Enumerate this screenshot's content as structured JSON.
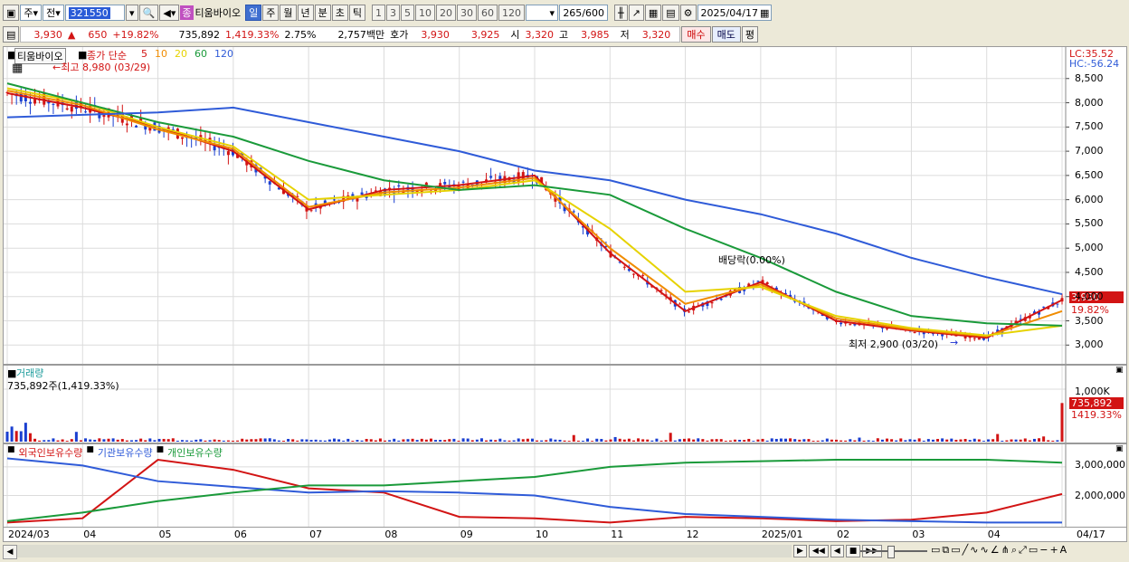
{
  "toolbar": {
    "period": "주",
    "all": "전",
    "code": "321550",
    "stock_badge": "종",
    "stock_name": "티움바이오",
    "timeframes": [
      "일",
      "주",
      "월",
      "년",
      "분",
      "초",
      "틱"
    ],
    "timeframe_selected": "일",
    "intervals": [
      "1",
      "3",
      "5",
      "10",
      "20",
      "30",
      "60",
      "120"
    ],
    "count": "265",
    "count_total": "/600",
    "date": "2025/04/17"
  },
  "quote": {
    "price": "3,930",
    "arrow": "▲",
    "change": "650",
    "change_pct": "+19.82%",
    "volume": "735,892",
    "volume_pct": "1,419.33%",
    "turnover": "2.75%",
    "amount": "2,757백만",
    "hoga_label": "호가",
    "ask": "3,930",
    "bid": "3,925",
    "open_label": "시",
    "open": "3,320",
    "high_label": "고",
    "high": "3,985",
    "low_label": "저",
    "low": "3,320",
    "buy": "매수",
    "sell": "매도",
    "eval": "평"
  },
  "price_pane": {
    "name": "티움바이오",
    "legend_prefix": "종가 단순",
    "ma": [
      {
        "label": "5",
        "color": "#d21414"
      },
      {
        "label": "10",
        "color": "#f08c00"
      },
      {
        "label": "20",
        "color": "#e6d200"
      },
      {
        "label": "60",
        "color": "#1a9a3a"
      },
      {
        "label": "120",
        "color": "#2f5bd8"
      }
    ],
    "high_note": "←최고 8,980 (03/29)",
    "low_note": "최저 2,900 (03/20)",
    "dividend_note": "배당락(0.00%)",
    "lc": "LC:35.52",
    "hc": "HC:-56.24",
    "current_price": "3,930",
    "current_pct": "19.82%",
    "yticks": [
      "8,500",
      "8,000",
      "7,500",
      "7,000",
      "6,500",
      "6,000",
      "5,500",
      "5,000",
      "4,500",
      "4,000",
      "3,500",
      "3,000"
    ]
  },
  "volume_pane": {
    "title": "거래량",
    "current": "735,892주(1,419.33%)",
    "ytick": "1,000K",
    "badge": "735,892",
    "badge_pct": "1419.33%"
  },
  "investor_pane": {
    "legend": [
      {
        "label": "외국인보유수량",
        "color": "#d21414"
      },
      {
        "label": "기관보유수량",
        "color": "#2f5bd8"
      },
      {
        "label": "개인보유수량",
        "color": "#1a9a3a"
      }
    ],
    "yticks": [
      "3,000,000",
      "2,000,000"
    ]
  },
  "xaxis": {
    "labels": [
      "2024/03",
      "04",
      "05",
      "06",
      "07",
      "08",
      "09",
      "10",
      "11",
      "12",
      "2025/01",
      "02",
      "03",
      "04"
    ],
    "right_label": "04/17"
  },
  "chart_data": {
    "type": "line",
    "title": "티움바이오",
    "ylim": [
      2800,
      9000
    ],
    "x": [
      "2024/03",
      "2024/04",
      "2024/05",
      "2024/06",
      "2024/07",
      "2024/08",
      "2024/09",
      "2024/10",
      "2024/11",
      "2024/12",
      "2025/01",
      "2025/02",
      "2025/03",
      "2025/04",
      "2025/04/17"
    ],
    "series": [
      {
        "name": "5",
        "values": [
          8200,
          7900,
          7500,
          7000,
          5800,
          6200,
          6300,
          6500,
          4900,
          3700,
          4300,
          3500,
          3300,
          3150,
          3930
        ]
      },
      {
        "name": "10",
        "values": [
          8250,
          7950,
          7450,
          7050,
          5850,
          6150,
          6250,
          6450,
          5000,
          3850,
          4250,
          3550,
          3320,
          3180,
          3700
        ]
      },
      {
        "name": "20",
        "values": [
          8300,
          8000,
          7500,
          7100,
          6000,
          6100,
          6200,
          6400,
          5400,
          4100,
          4200,
          3600,
          3350,
          3200,
          3400
        ]
      },
      {
        "name": "60",
        "values": [
          8400,
          8000,
          7600,
          7300,
          6800,
          6400,
          6200,
          6300,
          6100,
          5400,
          4800,
          4100,
          3600,
          3450,
          3400
        ]
      },
      {
        "name": "120",
        "values": [
          7700,
          7750,
          7800,
          7900,
          7600,
          7300,
          7000,
          6600,
          6400,
          6000,
          5700,
          5300,
          4800,
          4400,
          4050
        ]
      }
    ],
    "volume": {
      "ylim": [
        0,
        1000000
      ],
      "last": 735892
    },
    "holdings": {
      "ylim": [
        1000000,
        3600000
      ],
      "series": [
        {
          "name": "외국인보유수량",
          "values": [
            1050000,
            1200000,
            3250000,
            2900000,
            2250000,
            2100000,
            1250000,
            1200000,
            1050000,
            1250000,
            1200000,
            1100000,
            1150000,
            1400000,
            2050000
          ]
        },
        {
          "name": "기관보유수량",
          "values": [
            3300000,
            3050000,
            2500000,
            2300000,
            2100000,
            2150000,
            2100000,
            2000000,
            1600000,
            1350000,
            1250000,
            1150000,
            1100000,
            1050000,
            1050000
          ]
        },
        {
          "name": "개인보유수량",
          "values": [
            1100000,
            1400000,
            1800000,
            2100000,
            2350000,
            2350000,
            2500000,
            2650000,
            3000000,
            3150000,
            3200000,
            3250000,
            3250000,
            3250000,
            3150000
          ]
        }
      ]
    }
  }
}
